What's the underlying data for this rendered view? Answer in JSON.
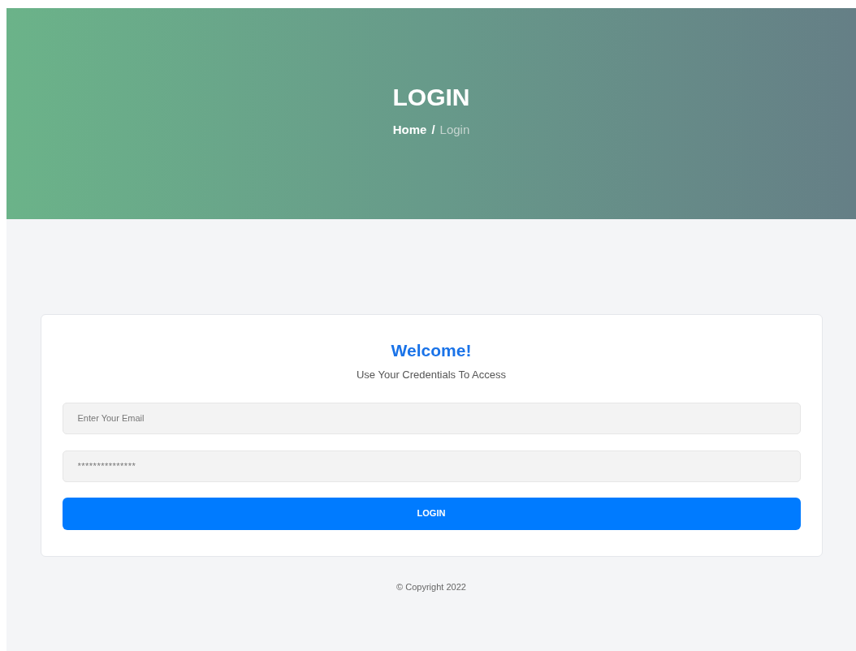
{
  "hero": {
    "title": "LOGIN",
    "breadcrumb": [
      {
        "label": "Home",
        "selected": false
      },
      {
        "label": "Login",
        "selected": true
      }
    ],
    "separator": "/"
  },
  "login_card": {
    "heading": "Welcome!",
    "subtitle": "Use Your Credentials To Access",
    "fields": [
      {
        "kind": "email",
        "placeholder": "Enter Your Email"
      },
      {
        "kind": "password",
        "placeholder": "***************"
      }
    ],
    "button": "LOGIN"
  },
  "footer": {
    "copyright": "© Copyright 2022"
  }
}
